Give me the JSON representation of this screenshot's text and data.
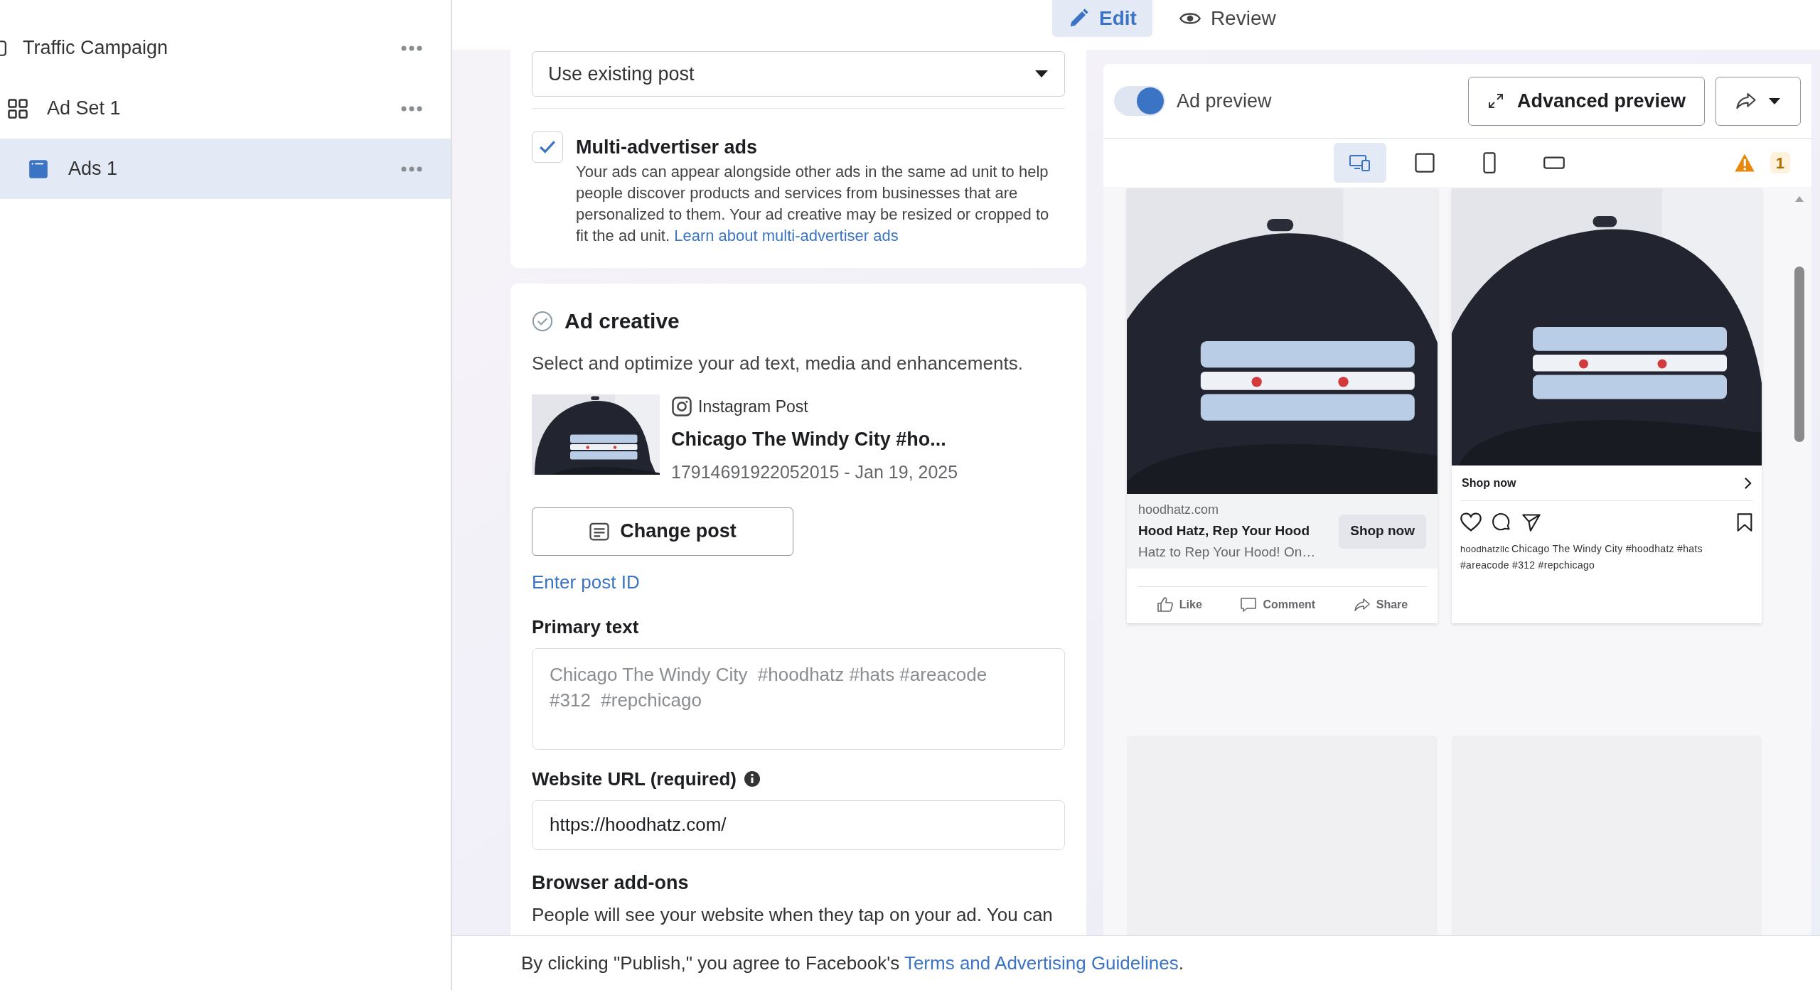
{
  "sidebar": {
    "items": [
      {
        "label": "Traffic Campaign",
        "kind": "campaign",
        "selected": false
      },
      {
        "label": "Ad Set 1",
        "kind": "adset",
        "selected": false
      },
      {
        "label": "Ads 1",
        "kind": "ad",
        "selected": true
      }
    ]
  },
  "mode_tabs": [
    {
      "label": "Edit",
      "kind": "edit",
      "selected": true
    },
    {
      "label": "Review",
      "kind": "review",
      "selected": false
    }
  ],
  "editor": {
    "post_source": {
      "value": "Use existing post"
    },
    "multi_advertiser": {
      "label": "Multi-advertiser ads",
      "checked": true,
      "description": "Your ads can appear alongside other ads in the same ad unit to help people discover products and services from businesses that are personalized to them. Your ad creative may be resized or cropped to fit the ad unit.",
      "link": "Learn about multi-advertiser ads"
    },
    "ad_creative": {
      "title": "Ad creative",
      "subtitle": "Select and optimize your ad text, media and enhancements.",
      "post": {
        "kind": "picture",
        "platform": "Instagram Post",
        "title": "Chicago The Windy City #ho...",
        "meta": "17914691922052015 - Jan 19, 2025"
      },
      "change_button": "Change post",
      "post_id_link": "Enter post ID"
    },
    "primary_text": {
      "label": "Primary text",
      "value": "Chicago The Windy City  #hoodhatz #hats #areacode #312  #repchicago"
    },
    "website_url": {
      "label": "Website URL (required)",
      "value": "https://hoodhatz.com/"
    },
    "browser_addons": {
      "title": "Browser add-ons",
      "description": "People will see your website when they tap on your ad. You can"
    }
  },
  "preview": {
    "toggle": {
      "label": "Ad preview",
      "on": true
    },
    "advanced_button": "Advanced preview",
    "formats": [
      {
        "kind": "responsive",
        "selected": true
      },
      {
        "kind": "square",
        "selected": false
      },
      {
        "kind": "vertical",
        "selected": false
      },
      {
        "kind": "horizontal",
        "selected": false
      }
    ],
    "warning_count": "1",
    "facebook_card": {
      "domain": "hoodhatz.com",
      "headline": "Hood Hatz, Rep Your Hood",
      "text": "Hatz to Rep Your Hood! On…",
      "cta": "Shop now",
      "actions": [
        {
          "kind": "like",
          "label": "Like"
        },
        {
          "kind": "comment",
          "label": "Comment"
        },
        {
          "kind": "share",
          "label": "Share"
        }
      ]
    },
    "instagram_card": {
      "cta": "Shop now",
      "username": "hoodhatzllc",
      "caption": "Chicago The Windy City #hoodhatz #hats #areacode #312 #repchicago"
    }
  },
  "footer": {
    "text": "By clicking \"Publish,\" you agree to Facebook's ",
    "link": "Terms and Advertising Guidelines",
    "end": "."
  }
}
